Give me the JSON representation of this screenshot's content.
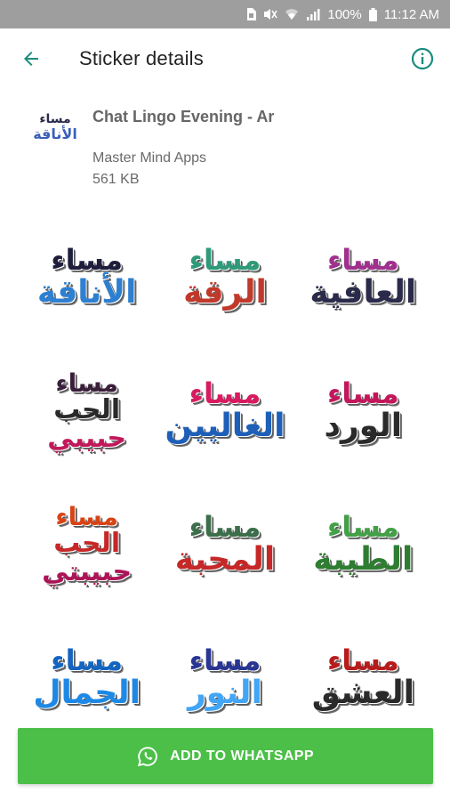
{
  "status_bar": {
    "battery_percent": "100%",
    "time": "11:12 AM",
    "icons": [
      "sim-card-icon",
      "mute-icon",
      "wifi-icon",
      "signal-icon",
      "battery-icon"
    ]
  },
  "app_bar": {
    "title": "Sticker details",
    "back_icon": "arrow-left-icon",
    "info_icon": "info-circle-icon",
    "accent_color": "#1b8c7e"
  },
  "pack": {
    "icon_text_line1": "مساء",
    "icon_text_line2": "الأناقة",
    "name": "Chat Lingo Evening - Ar",
    "publisher": "Master Mind Apps",
    "size": "561 KB"
  },
  "stickers": [
    {
      "lines": [
        "مساء",
        "الأناقة"
      ],
      "colors": [
        "#1e1e3c",
        "#2d7fd1"
      ]
    },
    {
      "lines": [
        "مساء",
        "الرقة"
      ],
      "colors": [
        "#2e9a7a",
        "#c0392b"
      ]
    },
    {
      "lines": [
        "مساء",
        "العافية"
      ],
      "colors": [
        "#a0308e",
        "#2a2a4a"
      ]
    },
    {
      "lines": [
        "مساء",
        "الحب",
        "حبيبي"
      ],
      "colors": [
        "#3a1f3a",
        "#2a2a2a",
        "#c2185b"
      ]
    },
    {
      "lines": [
        "مساء",
        "الغاليين"
      ],
      "colors": [
        "#d81b60",
        "#1e5fb8"
      ]
    },
    {
      "lines": [
        "مساء",
        "الورد"
      ],
      "colors": [
        "#c2185b",
        "#2a2a2a"
      ]
    },
    {
      "lines": [
        "مساء",
        "الحب",
        "حبيبتي"
      ],
      "colors": [
        "#d84315",
        "#c62828",
        "#ad1457"
      ]
    },
    {
      "lines": [
        "مساء",
        "المحبة"
      ],
      "colors": [
        "#3b6e4a",
        "#c62828"
      ]
    },
    {
      "lines": [
        "مساء",
        "الطيبة"
      ],
      "colors": [
        "#43a047",
        "#2e7d32"
      ]
    },
    {
      "lines": [
        "مساء",
        "الجمال"
      ],
      "colors": [
        "#1565c0",
        "#1e88e5"
      ]
    },
    {
      "lines": [
        "مساء",
        "النور"
      ],
      "colors": [
        "#283593",
        "#42a5f5"
      ]
    },
    {
      "lines": [
        "مساء",
        "العشق"
      ],
      "colors": [
        "#b71c1c",
        "#2a2a2a"
      ]
    }
  ],
  "add_button": {
    "label": "ADD TO WHATSAPP",
    "icon": "whatsapp-icon",
    "color": "#4bbf47"
  }
}
